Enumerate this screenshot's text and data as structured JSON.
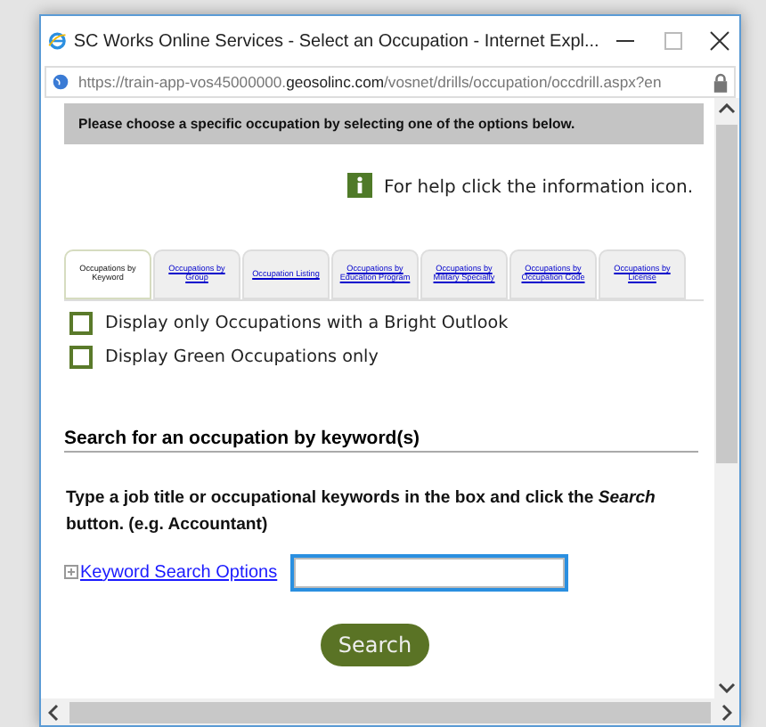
{
  "window": {
    "title": "SC Works Online Services - Select an Occupation - Internet Expl...",
    "url_parts": [
      "https://train-app-vos45000000.",
      "geosolinc.com",
      "/vosnet/drills/occupation/occdrill.aspx?en"
    ]
  },
  "banner": "Please choose a specific occupation by selecting one of the options below.",
  "help": "For help click the information icon.",
  "tabs": [
    {
      "label": "Occupations by Keyword",
      "selected": true
    },
    {
      "label": "Occupations by Group",
      "selected": false
    },
    {
      "label": "Occupation Listing",
      "selected": false
    },
    {
      "label": "Occupations by Education Program",
      "selected": false
    },
    {
      "label": "Occupations by Military Specialty",
      "selected": false
    },
    {
      "label": "Occupations by Occupation Code",
      "selected": false
    },
    {
      "label": "Occupations by License",
      "selected": false
    }
  ],
  "filters": [
    {
      "label": "Display only Occupations with a Bright Outlook",
      "checked": false
    },
    {
      "label": "Display Green Occupations only",
      "checked": false
    }
  ],
  "section_heading": "Search for an occupation by keyword(s)",
  "instructions": "Type a job title or occupational keywords in the box and click the *Search* button. (e.g. Accountant)",
  "options_link": "Keyword Search Options",
  "search_button": "Search"
}
